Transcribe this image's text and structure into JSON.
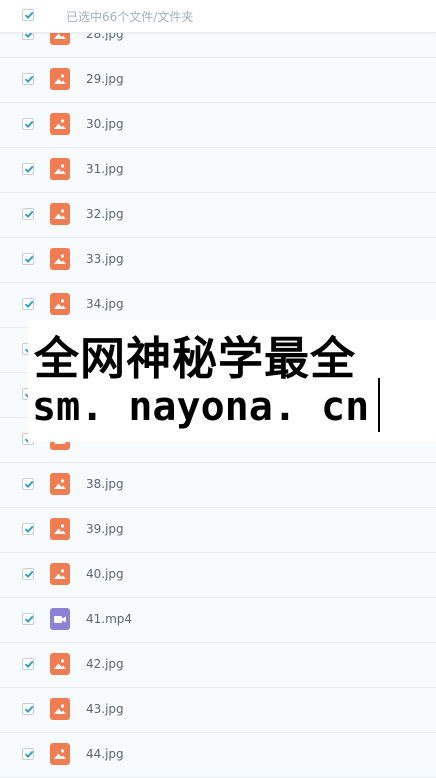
{
  "header": {
    "selection_text": "已选中66个文件/文件夹"
  },
  "files": [
    {
      "name": "28.jpg",
      "type": "image"
    },
    {
      "name": "29.jpg",
      "type": "image"
    },
    {
      "name": "30.jpg",
      "type": "image"
    },
    {
      "name": "31.jpg",
      "type": "image"
    },
    {
      "name": "32.jpg",
      "type": "image"
    },
    {
      "name": "33.jpg",
      "type": "image"
    },
    {
      "name": "34.jpg",
      "type": "image"
    },
    {
      "name": "",
      "type": "image"
    },
    {
      "name": "",
      "type": "image"
    },
    {
      "name": "",
      "type": "image"
    },
    {
      "name": "38.jpg",
      "type": "image"
    },
    {
      "name": "39.jpg",
      "type": "image"
    },
    {
      "name": "40.jpg",
      "type": "image"
    },
    {
      "name": "41.mp4",
      "type": "video"
    },
    {
      "name": "42.jpg",
      "type": "image"
    },
    {
      "name": "43.jpg",
      "type": "image"
    },
    {
      "name": "44.jpg",
      "type": "image"
    }
  ],
  "overlay": {
    "line1": "全网神秘学最全",
    "line2": "sm. nayona. cn"
  },
  "colors": {
    "check": "#3a9fc0",
    "image_icon": "#f07c51",
    "video_icon": "#8b82d8",
    "row_bg": "#f8fbfd"
  },
  "icons": {
    "checkbox": "check-icon",
    "image": "image-file-icon",
    "video": "video-file-icon"
  }
}
